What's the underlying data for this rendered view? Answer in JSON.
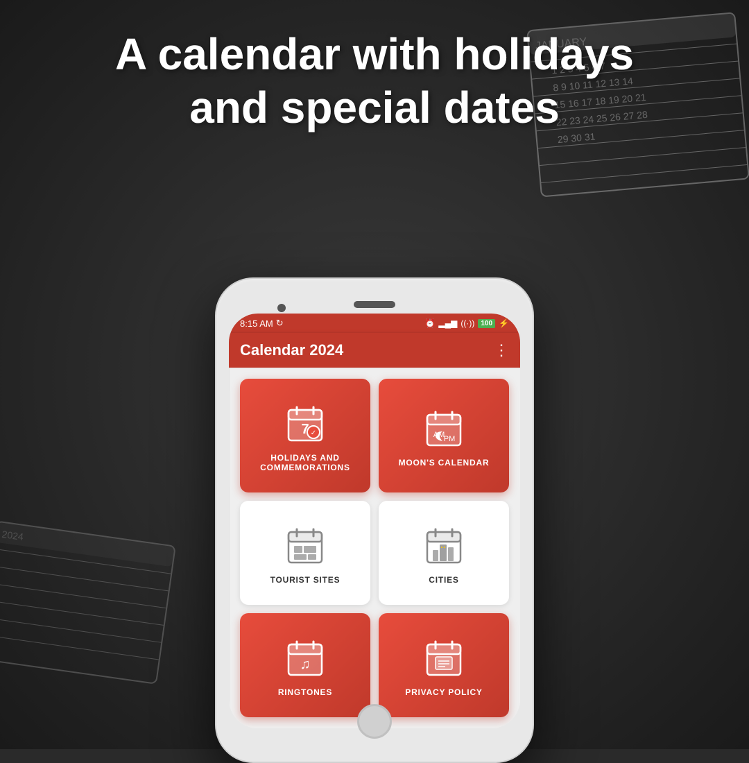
{
  "background": {
    "color": "#2a2a2a"
  },
  "header": {
    "title_line1": "A calendar with holidays",
    "title_line2": "and special dates"
  },
  "phone": {
    "status_bar": {
      "time": "8:15 AM",
      "sync_icon": "⟳",
      "alarm_icon": "⏰",
      "signal_icon": "📶",
      "wifi_icon": "📶",
      "battery_label": "100",
      "lightning_icon": "⚡"
    },
    "app_bar": {
      "title": "Calendar 2024",
      "menu_icon": "⋮"
    },
    "menu_cards": [
      {
        "id": "holidays",
        "label": "HOLIDAYS AND\nCOMMEMORATIONS",
        "type": "red",
        "icon_type": "calendar-7"
      },
      {
        "id": "moons",
        "label": "MOON'S CALENDAR",
        "type": "red",
        "icon_type": "calendar-moon"
      },
      {
        "id": "tourist",
        "label": "TOURIST SITES",
        "type": "white",
        "icon_type": "calendar-tourist"
      },
      {
        "id": "cities",
        "label": "CITIES",
        "type": "white",
        "icon_type": "calendar-city"
      },
      {
        "id": "ringtones",
        "label": "RINGTONES",
        "type": "red",
        "icon_type": "calendar-music"
      },
      {
        "id": "privacy",
        "label": "PRIVACY POLICY",
        "type": "red",
        "icon_type": "calendar-doc"
      }
    ]
  }
}
